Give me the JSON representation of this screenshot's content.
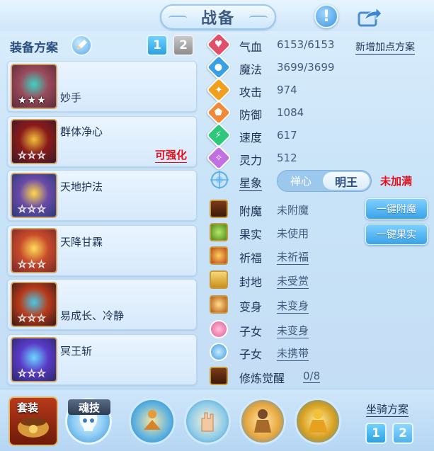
{
  "header": {
    "title": "战备"
  },
  "equip": {
    "scheme_label": "装备方案",
    "tabs": [
      "1",
      "2"
    ],
    "slots": [
      {
        "name": "妙手",
        "badge": "",
        "stars": "★★★",
        "star_style": "full",
        "colors": [
          "#5b2a3a",
          "#9a4a5a",
          "#3fd2c2"
        ]
      },
      {
        "name": "群体净心",
        "badge": "可强化",
        "stars": "☆☆☆",
        "star_style": "empty",
        "colors": [
          "#3a1a2a",
          "#8a1a1a",
          "#f2c23a"
        ]
      },
      {
        "name": "天地护法",
        "badge": "",
        "stars": "☆☆☆",
        "star_style": "empty",
        "colors": [
          "#2a3a7a",
          "#6a4aa8",
          "#ffd84a"
        ]
      },
      {
        "name": "天降甘霖",
        "badge": "",
        "stars": "☆☆☆",
        "star_style": "empty",
        "colors": [
          "#7a2a2a",
          "#c84a2a",
          "#ffde5a"
        ]
      },
      {
        "name": "易成长、冷静",
        "badge": "",
        "stars": "☆☆☆",
        "star_style": "empty",
        "colors": [
          "#3a1a1a",
          "#b83a1a",
          "#4ac8e8"
        ]
      },
      {
        "name": "冥王斩",
        "badge": "",
        "stars": "☆☆☆",
        "star_style": "empty",
        "colors": [
          "#2a2a6a",
          "#5a3ac8",
          "#6ad8ff"
        ]
      }
    ]
  },
  "stats": {
    "add_points_label": "新增加点方案",
    "rows": [
      {
        "name": "气血",
        "value": "6153/6153",
        "icon": "heart-icon",
        "color": "#e0506a"
      },
      {
        "name": "魔法",
        "value": "3699/3699",
        "icon": "droplet-icon",
        "color": "#3aa0e6"
      },
      {
        "name": "攻击",
        "value": "974",
        "icon": "sword-icon",
        "color": "#f0a020"
      },
      {
        "name": "防御",
        "value": "1084",
        "icon": "shield-icon",
        "color": "#f08a3a"
      },
      {
        "name": "速度",
        "value": "617",
        "icon": "lightning-icon",
        "color": "#2ec87a"
      },
      {
        "name": "灵力",
        "value": "512",
        "icon": "spirit-icon",
        "color": "#c070e0"
      }
    ]
  },
  "star_sign": {
    "label": "星象",
    "option_left": "禅心",
    "option_right": "明王",
    "status": "未加满"
  },
  "extras": {
    "rows": [
      {
        "name": "附魔",
        "value": "未附魔",
        "link": false
      },
      {
        "name": "果实",
        "value": "未使用",
        "link": false
      },
      {
        "name": "祈福",
        "value": "未祈福",
        "link": true
      },
      {
        "name": "封地",
        "value": "未受赏",
        "link": true
      },
      {
        "name": "变身",
        "value": "未变身",
        "link": true
      },
      {
        "name": "子女",
        "value": "未变身",
        "link": true
      },
      {
        "name": "子女",
        "value": "未携带",
        "link": true
      },
      {
        "name": "修炼觉醒",
        "value": "0/8",
        "link": true
      }
    ],
    "enchant_button": "一键附魔",
    "fruit_button": "一键果实"
  },
  "bottom": {
    "suit_label": "套装",
    "skill_label": "魂技",
    "mount_label": "坐骑方案",
    "mount_tabs": [
      "1",
      "2"
    ]
  }
}
